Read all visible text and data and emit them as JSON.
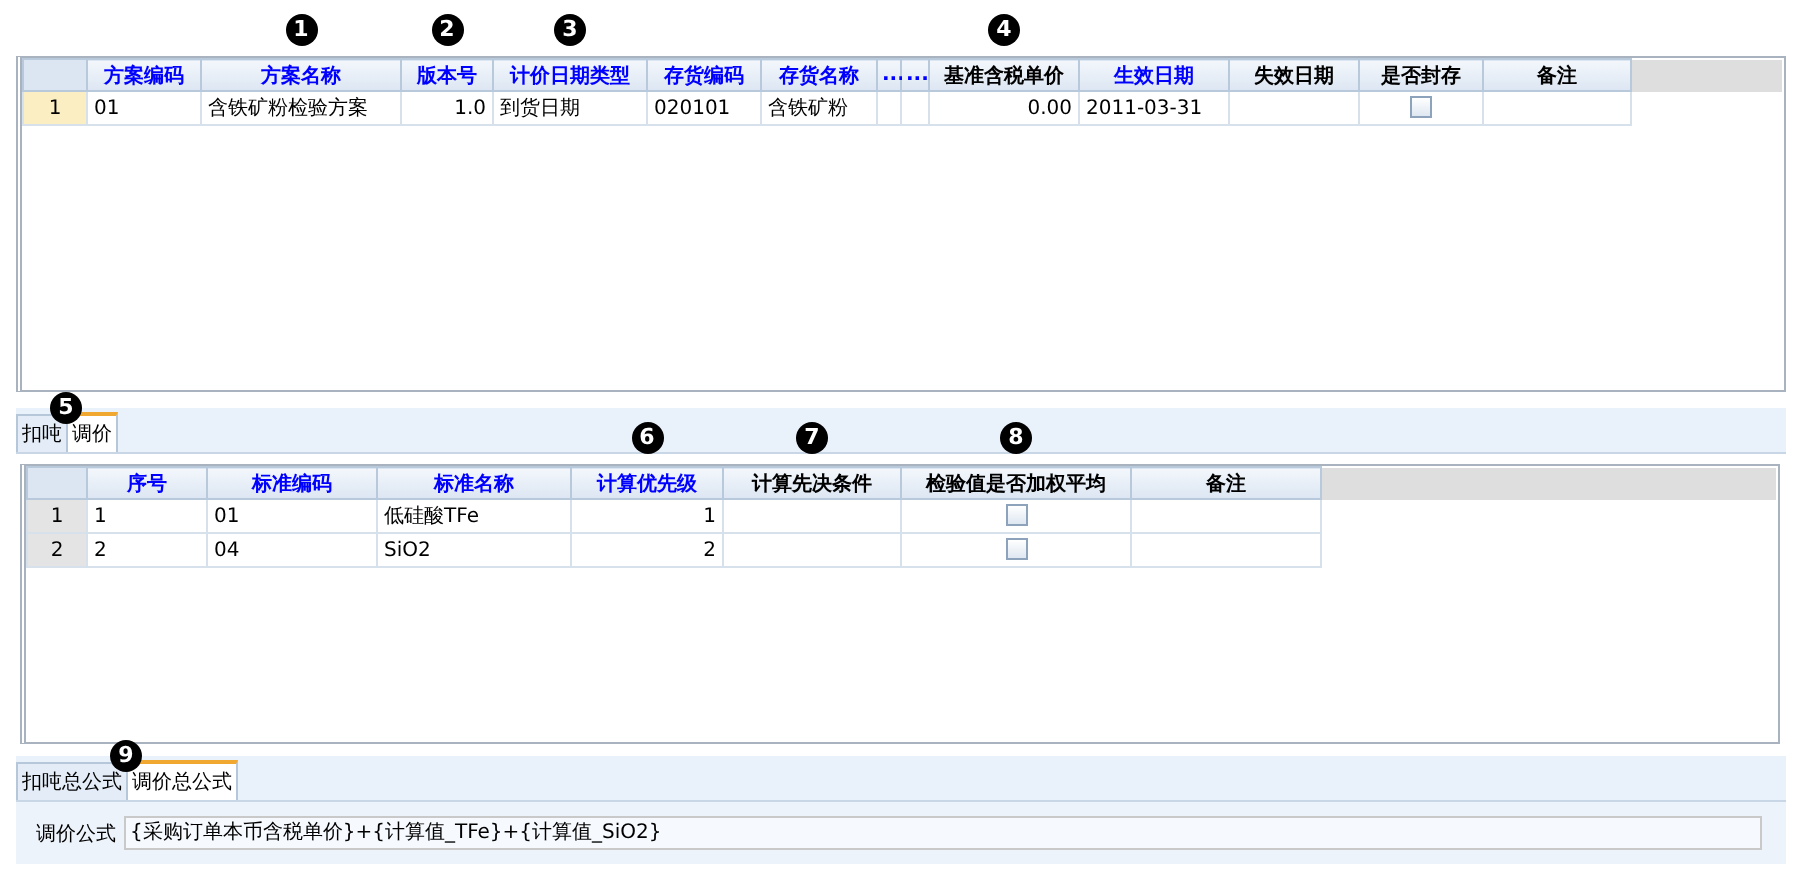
{
  "top_grid": {
    "columns": [
      {
        "label": "方案编码",
        "color": "#0000ff",
        "kind": "text"
      },
      {
        "label": "方案名称",
        "color": "#0000ff",
        "kind": "text",
        "marker": "1"
      },
      {
        "label": "版本号",
        "color": "#0000ff",
        "kind": "number",
        "marker": "2"
      },
      {
        "label": "计价日期类型",
        "color": "#0000ff",
        "kind": "text",
        "marker": "3"
      },
      {
        "label": "存货编码",
        "color": "#0000ff",
        "kind": "text"
      },
      {
        "label": "存货名称",
        "color": "#0000ff",
        "kind": "text"
      },
      {
        "label": "...",
        "color": "#0000ff",
        "kind": "text"
      },
      {
        "label": "...",
        "color": "#0000ff",
        "kind": "text"
      },
      {
        "label": "基准含税单价",
        "color": "#000000",
        "kind": "number",
        "marker": "4"
      },
      {
        "label": "生效日期",
        "color": "#0000ff",
        "kind": "text"
      },
      {
        "label": "失效日期",
        "color": "#000000",
        "kind": "text"
      },
      {
        "label": "是否封存",
        "color": "#000000",
        "kind": "checkbox"
      },
      {
        "label": "备注",
        "color": "#000000",
        "kind": "text"
      }
    ],
    "rows": [
      {
        "number": "1",
        "selected": true,
        "cells": [
          {
            "text": "01"
          },
          {
            "text": "含铁矿粉检验方案"
          },
          {
            "text": "1.0"
          },
          {
            "text": "到货日期"
          },
          {
            "text": "020101"
          },
          {
            "text": "含铁矿粉"
          },
          {},
          {},
          {
            "text": "0.00"
          },
          {
            "text": "2011-03-31"
          },
          {},
          {
            "checked": false
          },
          {}
        ]
      }
    ]
  },
  "detail_tabs": {
    "marker": "5",
    "items": [
      {
        "label": "扣吨",
        "selected": false
      },
      {
        "label": "调价",
        "selected": true
      }
    ]
  },
  "detail_grid": {
    "columns": [
      {
        "label": "序号",
        "color": "#0000ff",
        "kind": "text"
      },
      {
        "label": "标准编码",
        "color": "#0000ff",
        "kind": "text"
      },
      {
        "label": "标准名称",
        "color": "#0000ff",
        "kind": "text"
      },
      {
        "label": "计算优先级",
        "color": "#0000ff",
        "kind": "number",
        "marker": "6"
      },
      {
        "label": "计算先决条件",
        "color": "#000000",
        "kind": "text",
        "marker": "7"
      },
      {
        "label": "检验值是否加权平均",
        "color": "#000000",
        "kind": "checkbox",
        "marker": "8"
      },
      {
        "label": "备注",
        "color": "#000000",
        "kind": "text"
      }
    ],
    "rows": [
      {
        "number": "1",
        "selected": false,
        "cells": [
          {
            "text": "1"
          },
          {
            "text": "01"
          },
          {
            "text": "低硅酸TFe"
          },
          {
            "text": "1"
          },
          {},
          {
            "checked": false
          },
          {}
        ]
      },
      {
        "number": "2",
        "selected": false,
        "cells": [
          {
            "text": "2"
          },
          {
            "text": "04"
          },
          {
            "text": "SiO2"
          },
          {
            "text": "2"
          },
          {},
          {
            "checked": false
          },
          {}
        ]
      }
    ]
  },
  "formula_tabs": {
    "marker": "9",
    "items": [
      {
        "label": "扣吨总公式",
        "selected": false
      },
      {
        "label": "调价总公式",
        "selected": true
      }
    ]
  },
  "formula": {
    "label": "调价公式",
    "value": "{采购订单本币含税单价}+{计算值_TFe}+{计算值_SiO2}"
  }
}
